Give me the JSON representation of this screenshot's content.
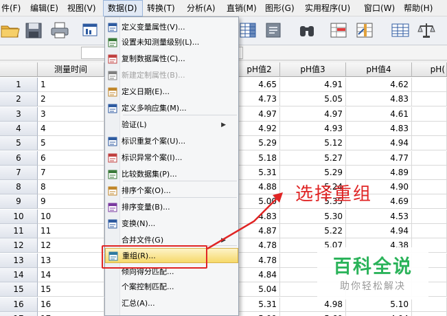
{
  "menubar": {
    "items": [
      "件(F)",
      "编辑(E)",
      "视图(V)",
      "数据(D)",
      "转换(T)",
      "分析(A)",
      "直销(M)",
      "图形(G)",
      "实用程序(U)",
      "窗口(W)",
      "帮助(H)"
    ]
  },
  "toolbar": {
    "icons": [
      "open-folder-icon",
      "save-icon",
      "print-icon",
      "dialog-recall-icon",
      "variables-grid-icon",
      "goto-case-icon",
      "find-binoculars-icon",
      "insert-cases-icon",
      "insert-variable-icon",
      "split-file-icon",
      "weight-cases-icon"
    ]
  },
  "grid": {
    "headers": [
      "",
      "测量时间",
      "pH值2",
      "pH值3",
      "pH值4",
      "pH("
    ],
    "rows": [
      {
        "n": "1",
        "t": "1",
        "ph2": "4.65",
        "ph3": "4.91",
        "ph4": "4.62"
      },
      {
        "n": "2",
        "t": "2",
        "ph2": "4.73",
        "ph3": "5.05",
        "ph4": "4.83"
      },
      {
        "n": "3",
        "t": "3",
        "ph2": "4.97",
        "ph3": "4.97",
        "ph4": "4.61"
      },
      {
        "n": "4",
        "t": "4",
        "ph2": "4.92",
        "ph3": "4.93",
        "ph4": "4.83"
      },
      {
        "n": "5",
        "t": "5",
        "ph2": "5.29",
        "ph3": "5.12",
        "ph4": "4.94"
      },
      {
        "n": "6",
        "t": "6",
        "ph2": "5.18",
        "ph3": "5.27",
        "ph4": "4.77"
      },
      {
        "n": "7",
        "t": "7",
        "ph2": "5.31",
        "ph3": "5.29",
        "ph4": "4.89"
      },
      {
        "n": "8",
        "t": "8",
        "ph2": "4.88",
        "ph3": "5.24",
        "ph4": "4.90"
      },
      {
        "n": "9",
        "t": "9",
        "ph2": "5.00",
        "ph3": "5.35",
        "ph4": "4.69"
      },
      {
        "n": "10",
        "t": "10",
        "ph2": "4.83",
        "ph3": "5.30",
        "ph4": "4.53"
      },
      {
        "n": "11",
        "t": "11",
        "ph2": "4.87",
        "ph3": "5.22",
        "ph4": "4.94"
      },
      {
        "n": "12",
        "t": "12",
        "ph2": "4.78",
        "ph3": "5.07",
        "ph4": "4.38"
      },
      {
        "n": "13",
        "t": "13",
        "ph2": "4.78",
        "ph3": "",
        "ph4": ""
      },
      {
        "n": "14",
        "t": "14",
        "ph2": "4.84",
        "ph3": "",
        "ph4": ""
      },
      {
        "n": "15",
        "t": "15",
        "ph2": "5.04",
        "ph3": "",
        "ph4": ""
      },
      {
        "n": "16",
        "t": "16",
        "ph2": "5.31",
        "ph3": "4.98",
        "ph4": "5.10"
      },
      {
        "n": "17",
        "t": "17",
        "ph2": "5.09",
        "ph3": "5.60",
        "ph4": "4.94"
      }
    ]
  },
  "dropdown": {
    "items": [
      {
        "label": "定义变量属性(V)...",
        "icon": "define-properties-icon"
      },
      {
        "label": "设置未知测量级别(L)...",
        "icon": "measure-level-icon"
      },
      {
        "label": "复制数据属性(C)...",
        "icon": "copy-properties-icon"
      },
      {
        "label": "新建定制属性(B)...",
        "icon": "custom-attribute-icon",
        "disabled": true
      },
      {
        "label": "定义日期(E)...",
        "icon": "define-dates-icon"
      },
      {
        "label": "定义多响应集(M)...",
        "icon": "multiple-response-icon"
      },
      {
        "label": "验证(L)",
        "icon": "",
        "submenu": true
      },
      {
        "label": "标识重复个案(U)...",
        "icon": "duplicate-cases-icon"
      },
      {
        "label": "标识异常个案(I)...",
        "icon": "unusual-cases-icon"
      },
      {
        "label": "比较数据集(P)...",
        "icon": "compare-datasets-icon"
      },
      {
        "label": "排序个案(O)...",
        "icon": "sort-cases-icon"
      },
      {
        "label": "排序变量(B)...",
        "icon": "sort-variables-icon"
      },
      {
        "label": "变换(N)...",
        "icon": "transpose-icon"
      },
      {
        "label": "合并文件(G)",
        "icon": "",
        "submenu": true
      },
      {
        "label": "重组(R)...",
        "icon": "restructure-icon",
        "highlighted": true
      },
      {
        "label": "倾向得分匹配...",
        "icon": ""
      },
      {
        "label": "个案控制匹配...",
        "icon": ""
      },
      {
        "label": "汇总(A)...",
        "icon": ""
      }
    ]
  },
  "annotation": {
    "text": "选择重组"
  },
  "watermark": {
    "title": "百科全说",
    "subtitle": "助你轻松解决"
  },
  "colors": {
    "accent_red": "#e02424",
    "menu_highlight": "#f6d96a",
    "watermark_green": "#2bb35a"
  }
}
